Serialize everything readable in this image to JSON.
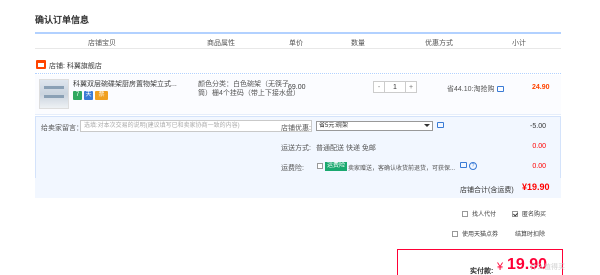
{
  "page": {
    "title": "确认订单信息"
  },
  "table_header": {
    "columns": [
      "店铺宝贝",
      "商品属性",
      "单价",
      "数量",
      "优惠方式",
      "小计"
    ]
  },
  "shop": {
    "prefix": "店铺:",
    "name": "科翼旗舰店"
  },
  "item": {
    "title_line1": "科翼双层碗碟架厨房置物架立式...",
    "attr_line1": "颜色分类：白色碗架（无筷子",
    "attr_line2": "筒）栅4个挂码（带上下接水盘）",
    "price": "69.00",
    "qty_minus": "-",
    "qty": "1",
    "qty_plus": "+",
    "promo": "省44.10:淘抢购",
    "subtotal": "24.90",
    "badges": [
      "7",
      "天",
      "票"
    ]
  },
  "extras": {
    "message_label": "给卖家留言：",
    "message_placeholder": "选填:对本次交易的说明(建议填写已和卖家协商一致的内容)",
    "shop_promo_label": "店铺优惠:",
    "shop_promo_value": "省5元:碗架",
    "shop_promo_amount": "-5.00",
    "shipping_label": "运送方式:",
    "shipping_value": "普通配送 快递 免邮",
    "shipping_amount": "0.00",
    "insurance_label": "运费险:",
    "insurance_tag": "运费险",
    "insurance_text": "卖家赠送，客确认收货前退货，可获保...",
    "insurance_amount": "0.00",
    "question_mark": "?"
  },
  "shop_total": {
    "label": "店铺合计(含运费)",
    "value": "¥19.90"
  },
  "options": {
    "pay_for_other": "找人代付",
    "anonymous": "匿名购买",
    "use_coupon": "使用天猫点券",
    "coupon_note": "结算时扣除"
  },
  "payment": {
    "label": "实付款:",
    "currency": "¥",
    "value": "19.90"
  },
  "watermark": "什么值得买"
}
